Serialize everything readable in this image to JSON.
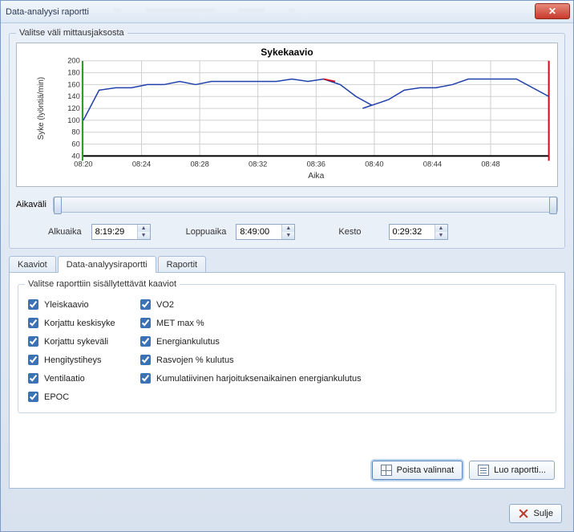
{
  "window": {
    "title": "Data-analyysi raportti"
  },
  "measure_group": {
    "legend": "Valitse väli mittausjaksosta"
  },
  "chart_data": {
    "type": "line",
    "title": "Sykekaavio",
    "xlabel": "Aika",
    "ylabel": "Syke (lyöntiä/min)",
    "ylim": [
      40,
      200
    ],
    "yticks": [
      40,
      60,
      80,
      100,
      120,
      140,
      160,
      180,
      200
    ],
    "xticks": [
      "08:20",
      "08:24",
      "08:28",
      "08:32",
      "08:36",
      "08:40",
      "08:44",
      "08:48"
    ],
    "series": [
      {
        "name": "Syke",
        "color": "#2040aa",
        "x": [
          "08:20",
          "08:21",
          "08:22",
          "08:23",
          "08:24",
          "08:25",
          "08:26",
          "08:27",
          "08:28",
          "08:29",
          "08:30",
          "08:31",
          "08:32",
          "08:33",
          "08:34",
          "08:35",
          "08:36",
          "08:37",
          "08:38",
          "08:39",
          "08:40",
          "08:41",
          "08:42",
          "08:43",
          "08:44",
          "08:45",
          "08:46",
          "08:47",
          "08:48",
          "08:49"
        ],
        "values": [
          100,
          150,
          155,
          155,
          160,
          160,
          165,
          160,
          165,
          165,
          165,
          165,
          165,
          170,
          165,
          170,
          170,
          160,
          140,
          125,
          120,
          135,
          150,
          155,
          155,
          160,
          170,
          170,
          170,
          140
        ]
      }
    ],
    "highlight_segments": [
      {
        "color": "#d01020",
        "x_range": [
          "08:35.5",
          "08:36.3"
        ]
      },
      {
        "color": "#d01020",
        "x_range": [
          "08:48.8",
          "08:49"
        ]
      }
    ],
    "left_marker": {
      "x": "08:19.5",
      "color": "#2e9a2e"
    }
  },
  "slider": {
    "label": "Aikaväli"
  },
  "times": {
    "start_label": "Alkuaika",
    "start_value": "8:19:29",
    "end_label": "Loppuaika",
    "end_value": "8:49:00",
    "duration_label": "Kesto",
    "duration_value": "0:29:32"
  },
  "tabs": {
    "items": [
      {
        "id": "kaaviot",
        "label": "Kaaviot"
      },
      {
        "id": "raportti",
        "label": "Data-analyysiraportti"
      },
      {
        "id": "raportit",
        "label": "Raportit"
      }
    ],
    "active": "raportti"
  },
  "report_group": {
    "legend": "Valitse raporttiin sisällytettävät kaaviot",
    "left_col": [
      {
        "id": "yleiskaavio",
        "label": "Yleiskaavio",
        "checked": true
      },
      {
        "id": "korjattu-keskisyke",
        "label": "Korjattu keskisyke",
        "checked": true
      },
      {
        "id": "korjattu-sykevali",
        "label": "Korjattu sykeväli",
        "checked": true
      },
      {
        "id": "hengitystiheys",
        "label": "Hengitystiheys",
        "checked": true
      },
      {
        "id": "ventilaatio",
        "label": "Ventilaatio",
        "checked": true
      },
      {
        "id": "epoc",
        "label": "EPOC",
        "checked": true
      }
    ],
    "right_col": [
      {
        "id": "vo2",
        "label": "VO2",
        "checked": true
      },
      {
        "id": "met-max",
        "label": "MET max %",
        "checked": true
      },
      {
        "id": "energiankulutus",
        "label": "Energiankulutus",
        "checked": true
      },
      {
        "id": "rasvojen",
        "label": "Rasvojen % kulutus",
        "checked": true
      },
      {
        "id": "kumulatiivinen",
        "label": "Kumulatiivinen harjoituksenaikainen energiankulutus",
        "checked": true
      }
    ]
  },
  "buttons": {
    "clear": "Poista valinnat",
    "create": "Luo raportti...",
    "close": "Sulje"
  }
}
